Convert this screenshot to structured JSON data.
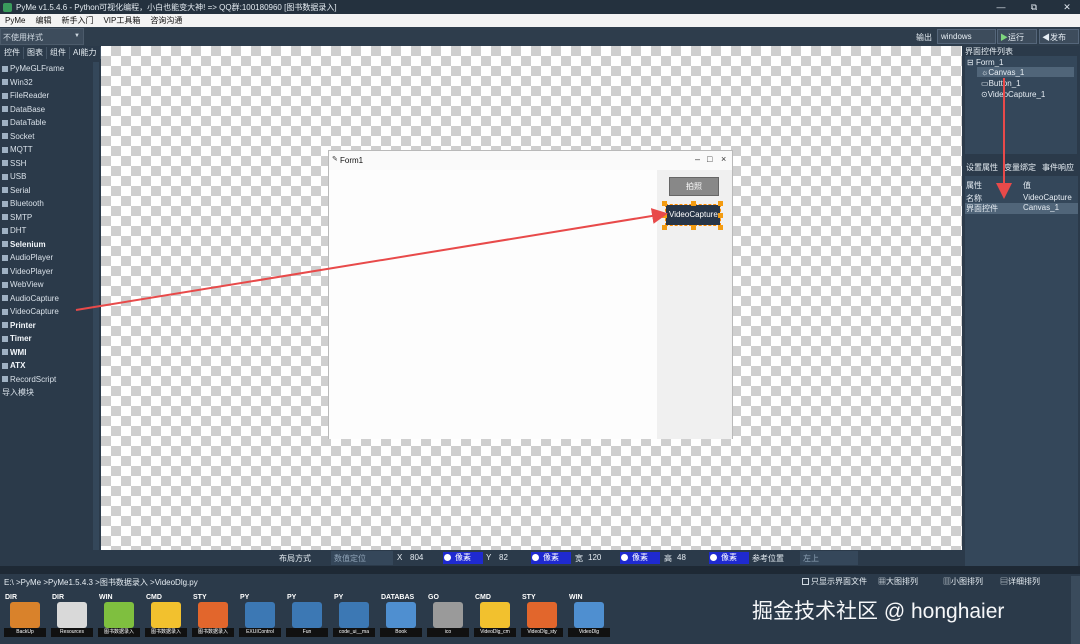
{
  "window": {
    "title": "PyMe v1.5.4.6 - Python可视化编程，小白也能变大神!   => QQ群:100180960    [图书数据录入]",
    "controls": [
      "—",
      "⧉",
      "✕"
    ]
  },
  "menu": [
    "PyMe",
    "编辑",
    "新手入门",
    "VIP工具箱",
    "咨询沟通"
  ],
  "toolbar": {
    "style_select": "不使用样式",
    "output_label": "输出",
    "platform": "windows",
    "run_label": "运行",
    "publish_label": "发布"
  },
  "left_tabs": [
    "控件",
    "图表",
    "组件",
    "AI能力"
  ],
  "widgets": [
    {
      "label": "PyMeGLFrame",
      "icon": "frame-icon"
    },
    {
      "label": "Win32",
      "icon": "win32-icon"
    },
    {
      "label": "FileReader",
      "icon": "file-icon"
    },
    {
      "label": "DataBase",
      "icon": "database-icon"
    },
    {
      "label": "DataTable",
      "icon": "table-icon"
    },
    {
      "label": "Socket",
      "icon": "socket-icon"
    },
    {
      "label": "MQTT",
      "icon": "mqtt-icon"
    },
    {
      "label": "SSH",
      "icon": "ssh-icon"
    },
    {
      "label": "USB",
      "icon": "usb-icon"
    },
    {
      "label": "Serial",
      "icon": "serial-icon"
    },
    {
      "label": "Bluetooth",
      "icon": "bluetooth-icon"
    },
    {
      "label": "SMTP",
      "icon": "mail-icon"
    },
    {
      "label": "DHT",
      "icon": "dht-icon"
    },
    {
      "label": "Selenium",
      "icon": "selenium-icon",
      "strong": true
    },
    {
      "label": "AudioPlayer",
      "icon": "audio-icon"
    },
    {
      "label": "VideoPlayer",
      "icon": "video-icon"
    },
    {
      "label": "WebView",
      "icon": "web-icon"
    },
    {
      "label": "AudioCapture",
      "icon": "mic-icon"
    },
    {
      "label": "VideoCapture",
      "icon": "camera-icon"
    },
    {
      "label": "Printer",
      "icon": "printer-icon",
      "strong": true
    },
    {
      "label": "Timer",
      "icon": "timer-icon",
      "strong": true
    },
    {
      "label": "WMI",
      "icon": "wmi-icon",
      "strong": true
    },
    {
      "label": "ATX",
      "icon": "atx-icon",
      "strong": true
    },
    {
      "label": "RecordScript",
      "icon": "record-icon"
    },
    {
      "label": "导入模块",
      "icon": ""
    }
  ],
  "form": {
    "title": "Form1",
    "button_label": "拍照",
    "videocapture_label": "VideoCapture"
  },
  "tree": {
    "title": "界面控件列表",
    "nodes": [
      "Form_1",
      "Canvas_1",
      "Button_1",
      "VideoCapture_1"
    ]
  },
  "prop_tabs": [
    "设置属性",
    "变量绑定",
    "事件响应"
  ],
  "props": {
    "header": {
      "k": "属性",
      "v": "值"
    },
    "rows": [
      {
        "k": "名称",
        "v": "VideoCapture"
      },
      {
        "k": "界面控件",
        "v": "Canvas_1"
      }
    ]
  },
  "bottom": {
    "layout_label": "布局方式",
    "layout_value": "数值定位",
    "x_label": "X",
    "x_value": "804",
    "y_label": "Y",
    "y_value": "82",
    "w_label": "宽",
    "w_value": "120",
    "h_label": "高",
    "h_value": "48",
    "unit": "像素",
    "ref_label": "参考位置",
    "ref_value": "左上"
  },
  "path": "E:\\ >PyMe >PyMe1.5.4.3 >图书数据录入 >VideoDlg.py",
  "view_options": [
    "只显示界面文件",
    "大图排列",
    "小图排列",
    "详细排列"
  ],
  "files": [
    {
      "tag": "DIR",
      "label": "BackUp",
      "color": "#d9822b"
    },
    {
      "tag": "DIR",
      "label": "Resources",
      "color": "#d9d9d9"
    },
    {
      "tag": "WIN",
      "label": "图书数据录入",
      "color": "#7fbf3f"
    },
    {
      "tag": "CMD",
      "label": "图书数据录入",
      "color": "#f2c12e"
    },
    {
      "tag": "STY",
      "label": "图书数据录入",
      "color": "#e2662c"
    },
    {
      "tag": "PY",
      "label": "EXUIControl",
      "color": "#3c78b4"
    },
    {
      "tag": "PY",
      "label": "Fun",
      "color": "#3c78b4"
    },
    {
      "tag": "PY",
      "label": "code_ui__ma",
      "color": "#3c78b4"
    },
    {
      "tag": "DATABAS",
      "label": "Book",
      "color": "#4f8fd0"
    },
    {
      "tag": "GO",
      "label": "ico",
      "color": "#9a9a9a"
    },
    {
      "tag": "CMD",
      "label": "VideoDlg_cm",
      "color": "#f2c12e"
    },
    {
      "tag": "STY",
      "label": "VideoDlg_sty",
      "color": "#e2662c"
    },
    {
      "tag": "WIN",
      "label": "VideoDlg",
      "color": "#4f8fd0"
    }
  ],
  "watermark": "掘金技术社区 @ honghaier",
  "colors": {
    "arrow": "#e84a4a",
    "selection": "#f39c12"
  }
}
